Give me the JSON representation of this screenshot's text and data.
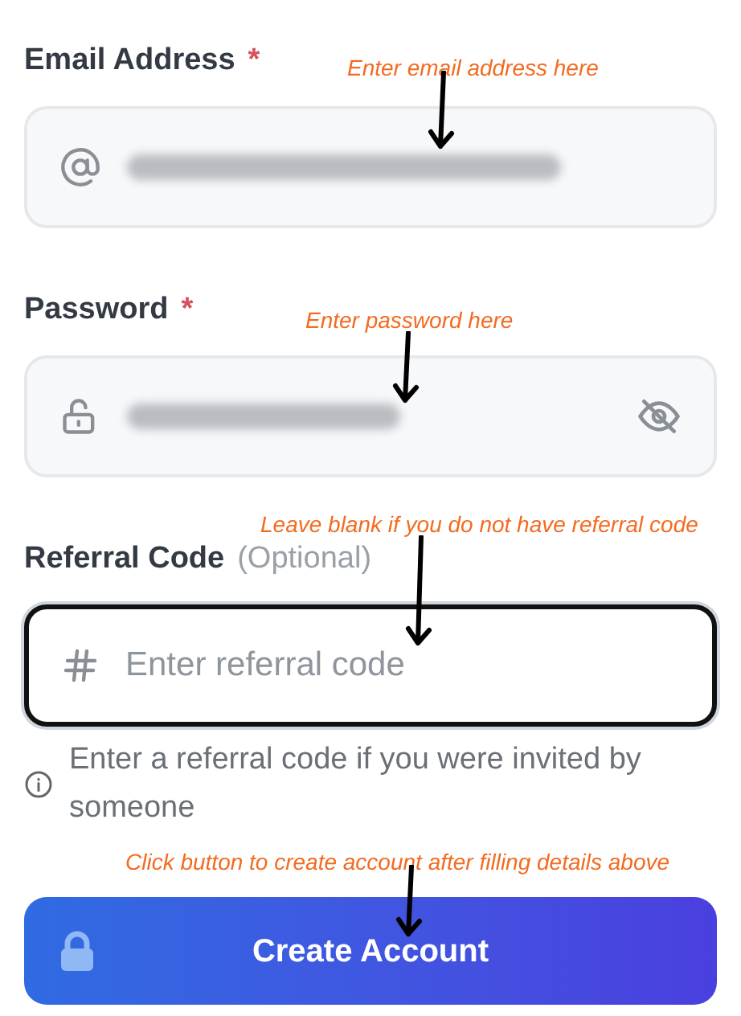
{
  "fields": [
    {
      "kind": "email",
      "label": "Email Address",
      "required_mark": "*",
      "blurred": true,
      "focused": false,
      "annotation": "Enter email address here"
    },
    {
      "kind": "password",
      "label": "Password",
      "required_mark": "*",
      "blurred": true,
      "focused": false,
      "annotation": "Enter password here"
    },
    {
      "kind": "code",
      "label": "Referral Code",
      "optional_note": "(Optional)",
      "focused": true,
      "placeholder": "Enter referral code",
      "annotation": "Leave blank if you do not have referral code",
      "help": "Enter a referral code if you were invited by someone"
    }
  ],
  "button": {
    "label": "Create Account",
    "annotation": "Click button to create account after filling details above"
  }
}
